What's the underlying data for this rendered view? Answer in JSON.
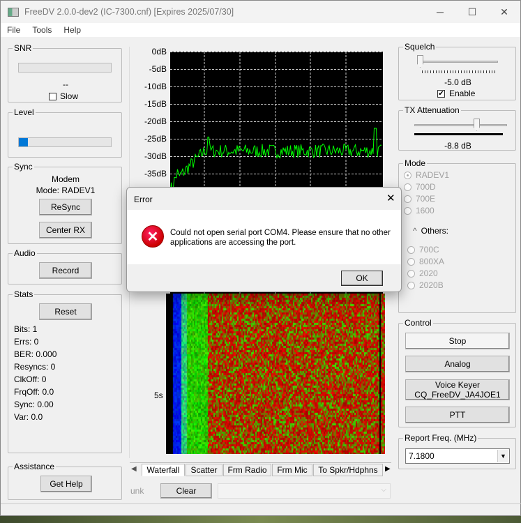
{
  "window": {
    "title": "FreeDV 2.0.0-dev2 (IC-7300.cnf) [Expires 2025/07/30]",
    "minimize": "─",
    "maximize": "☐",
    "close": "✕"
  },
  "menu": [
    "File",
    "Tools",
    "Help"
  ],
  "snr": {
    "label": "SNR",
    "value": "--",
    "slow_label": "Slow",
    "slow_checked": false
  },
  "level": {
    "label": "Level",
    "fill_fraction": 0.1
  },
  "sync": {
    "label": "Sync",
    "line1": "Modem",
    "line2": "Mode: RADEV1",
    "resync": "ReSync",
    "center_rx": "Center RX"
  },
  "audio": {
    "label": "Audio",
    "record": "Record"
  },
  "stats": {
    "label": "Stats",
    "reset": "Reset",
    "lines": [
      "Bits: 1",
      "Errs: 0",
      "BER: 0.000",
      "Resyncs: 0",
      "ClkOff: 0",
      "FrqOff: 0.0",
      "Sync: 0.00",
      "Var:  0.0"
    ]
  },
  "assistance": {
    "label": "Assistance",
    "get_help": "Get Help"
  },
  "spectrum": {
    "y_ticks": [
      "0dB",
      "-5dB",
      "-10dB",
      "-15dB",
      "-20dB",
      "-25dB",
      "-30dB",
      "-35dB"
    ],
    "trace_color": "#00ff00"
  },
  "waterfall": {
    "time_label": "5s"
  },
  "tabs": [
    "Waterfall",
    "Scatter",
    "Frm Radio",
    "Frm Mic",
    "To Spkr/Hdphns"
  ],
  "bottom": {
    "unk": "unk",
    "clear": "Clear",
    "combo_value": ""
  },
  "squelch": {
    "label": "Squelch",
    "value": "-5.0 dB",
    "enable_label": "Enable",
    "enabled": true,
    "slider_fraction": 0.0
  },
  "tx_attenuation": {
    "label": "TX Attenuation",
    "value": "-8.8 dB",
    "slider_fraction": 0.72
  },
  "mode": {
    "label": "Mode",
    "options": [
      "RADEV1",
      "700D",
      "700E",
      "1600"
    ],
    "others_label": "Others:",
    "others": [
      "700C",
      "800XA",
      "2020",
      "2020B"
    ],
    "selected": "RADEV1"
  },
  "control": {
    "label": "Control",
    "stop": "Stop",
    "analog": "Analog",
    "voice_keyer_1": "Voice Keyer",
    "voice_keyer_2": "CQ_FreeDV_JA4JOE1",
    "ptt": "PTT"
  },
  "report_freq": {
    "label": "Report Freq. (MHz)",
    "value": "7.1800"
  },
  "dialog": {
    "title": "Error",
    "message": "Could not open serial port COM4. Please ensure that no other applications are accessing the port.",
    "ok": "OK",
    "close": "✕"
  }
}
